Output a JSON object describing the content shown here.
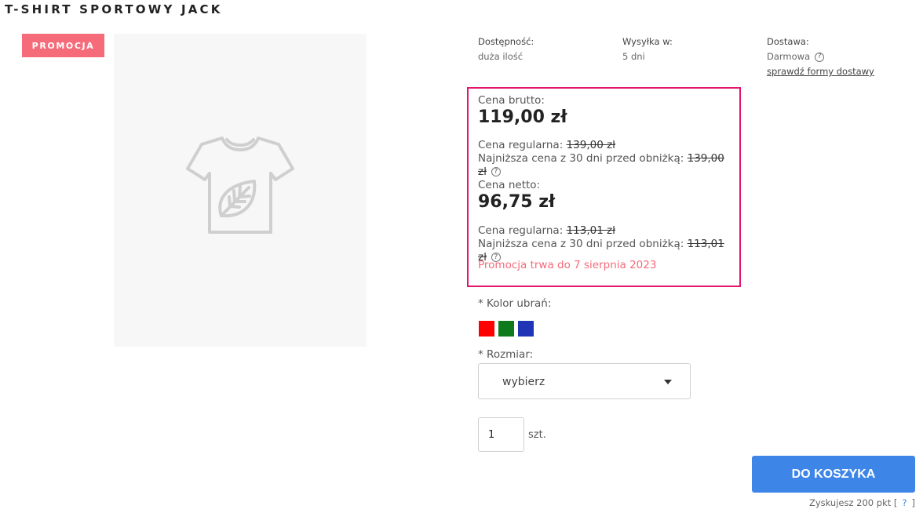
{
  "product": {
    "title": "T-SHIRT SPORTOWY JACK",
    "badge": "PROMOCJA"
  },
  "availability": {
    "label": "Dostępność:",
    "value": "duża ilość"
  },
  "shipping": {
    "label": "Wysyłka w:",
    "value": "5 dni"
  },
  "delivery": {
    "label": "Dostawa:",
    "value": "Darmowa",
    "help": "?",
    "link": "sprawdź formy dostawy"
  },
  "price": {
    "brutto_label": "Cena brutto:",
    "brutto": "119,00 zł",
    "regular_label": "Cena regularna:",
    "regular_brutto": "139,00 zł",
    "lowest_label": "Najniższa cena z 30 dni przed obniżką:",
    "lowest_brutto": "139,00 zł",
    "netto_label": "Cena netto:",
    "netto": "96,75 zł",
    "regular_netto": "113,01 zł",
    "lowest_netto": "113,01 zł",
    "help": "?",
    "promo_info": "Promocja trwa do 7 sierpnia 2023"
  },
  "options": {
    "color_label": "* Kolor ubrań:",
    "colors": [
      "#ff0000",
      "#0e7a1c",
      "#2035b5"
    ],
    "size_label": "* Rozmiar:",
    "size_value": "wybierz",
    "qty_value": "1",
    "qty_unit": "szt."
  },
  "cart": {
    "button": "DO KOSZYKA",
    "points_text": "Zyskujesz 200 pkt [",
    "points_help": "?",
    "points_close": "]"
  },
  "icons": [
    "tshirt-leaf-icon",
    "help-icon",
    "caret-down-icon"
  ]
}
